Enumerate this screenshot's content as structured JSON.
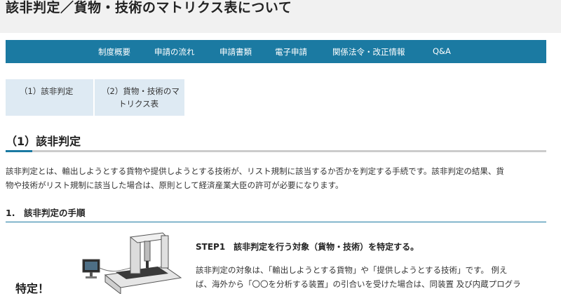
{
  "page": {
    "title": "該非判定／貨物・技術のマトリクス表について"
  },
  "nav": {
    "items": [
      "制度概要",
      "申請の流れ",
      "申請書類",
      "電子申請",
      "関係法令・改正情報",
      "Q&A"
    ]
  },
  "tabs": [
    {
      "line1": "（1）該非判定",
      "line2": ""
    },
    {
      "line1": "（2）貨物・技術のマ",
      "line2": "トリクス表"
    }
  ],
  "section": {
    "title": "（1）該非判定",
    "body_line1": "該非判定とは、輸出しようとする貨物や提供しようとする技術が、リスト規制に該当するか否かを判定する手続です。該非判定の結果、貨",
    "body_line2": "物や技術がリスト規制に該当した場合は、原則として経済産業大臣の許可が必要になります。"
  },
  "subsection": {
    "title": "1.　該非判定の手順"
  },
  "illustration": {
    "label": "特定！"
  },
  "step": {
    "title": "STEP1　該非判定を行う対象（貨物・技術）を特定する。",
    "line1": "該非判定の対象は、「輸出しようとする貨物」や「提供しようとする技術」です。 例え",
    "line2": "ば、海外から「〇〇を分析する装置」の引合いを受けた場合は、同装置 及び内蔵プログラ"
  },
  "colors": {
    "nav_bg": "#1b7aa2",
    "tab_bg": "#deeaf3",
    "title_bar_bg": "#f1f1f1"
  }
}
